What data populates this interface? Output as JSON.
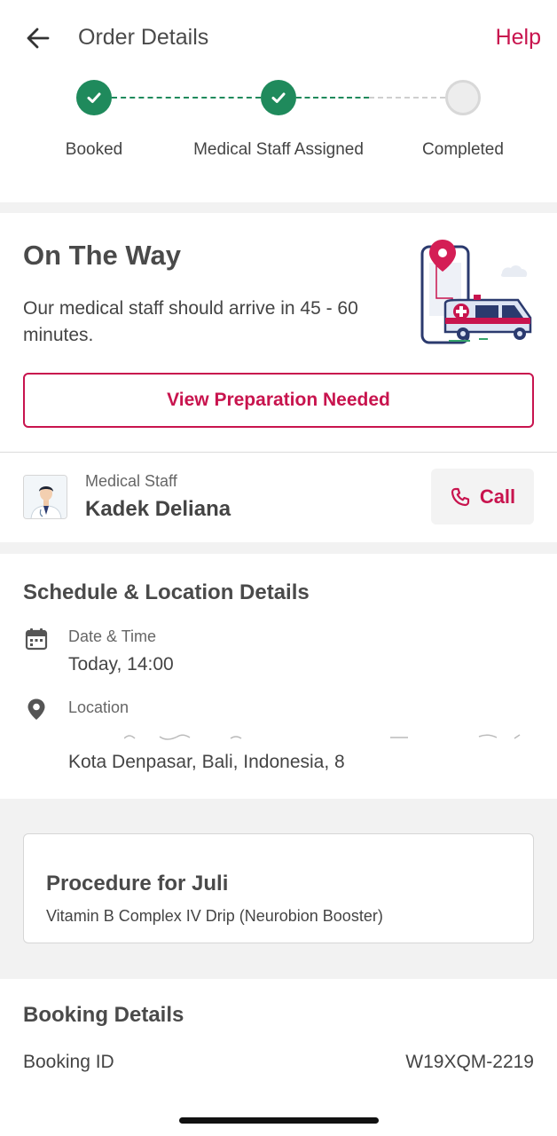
{
  "header": {
    "title": "Order Details",
    "help_label": "Help"
  },
  "stepper": {
    "steps": [
      {
        "label": "Booked",
        "state": "done"
      },
      {
        "label": "Medical Staff Assigned",
        "state": "done"
      },
      {
        "label": "Completed",
        "state": "pending"
      }
    ]
  },
  "status": {
    "title": "On The Way",
    "description": "Our medical staff should arrive in 45 - 60 minutes.",
    "prep_button_label": "View Preparation Needed"
  },
  "staff": {
    "caption": "Medical Staff",
    "name": "Kadek Deliana",
    "call_label": "Call"
  },
  "schedule": {
    "section_title": "Schedule & Location Details",
    "date_caption": "Date & Time",
    "date_value": "Today, 14:00",
    "location_caption": "Location",
    "location_value": "Kota Denpasar, Bali, Indonesia, 8"
  },
  "procedure": {
    "title": "Procedure for Juli",
    "description": "Vitamin B Complex IV Drip (Neurobion Booster)"
  },
  "booking": {
    "section_title": "Booking Details",
    "id_label": "Booking ID",
    "id_value": "W19XQM-2219"
  },
  "colors": {
    "accent": "#c8144e",
    "success": "#1f8a5c",
    "band": "#f2f2f2"
  },
  "icons": [
    "back-arrow-icon",
    "check-icon",
    "ambulance-illustration",
    "phone-icon",
    "calendar-icon",
    "location-pin-icon"
  ]
}
